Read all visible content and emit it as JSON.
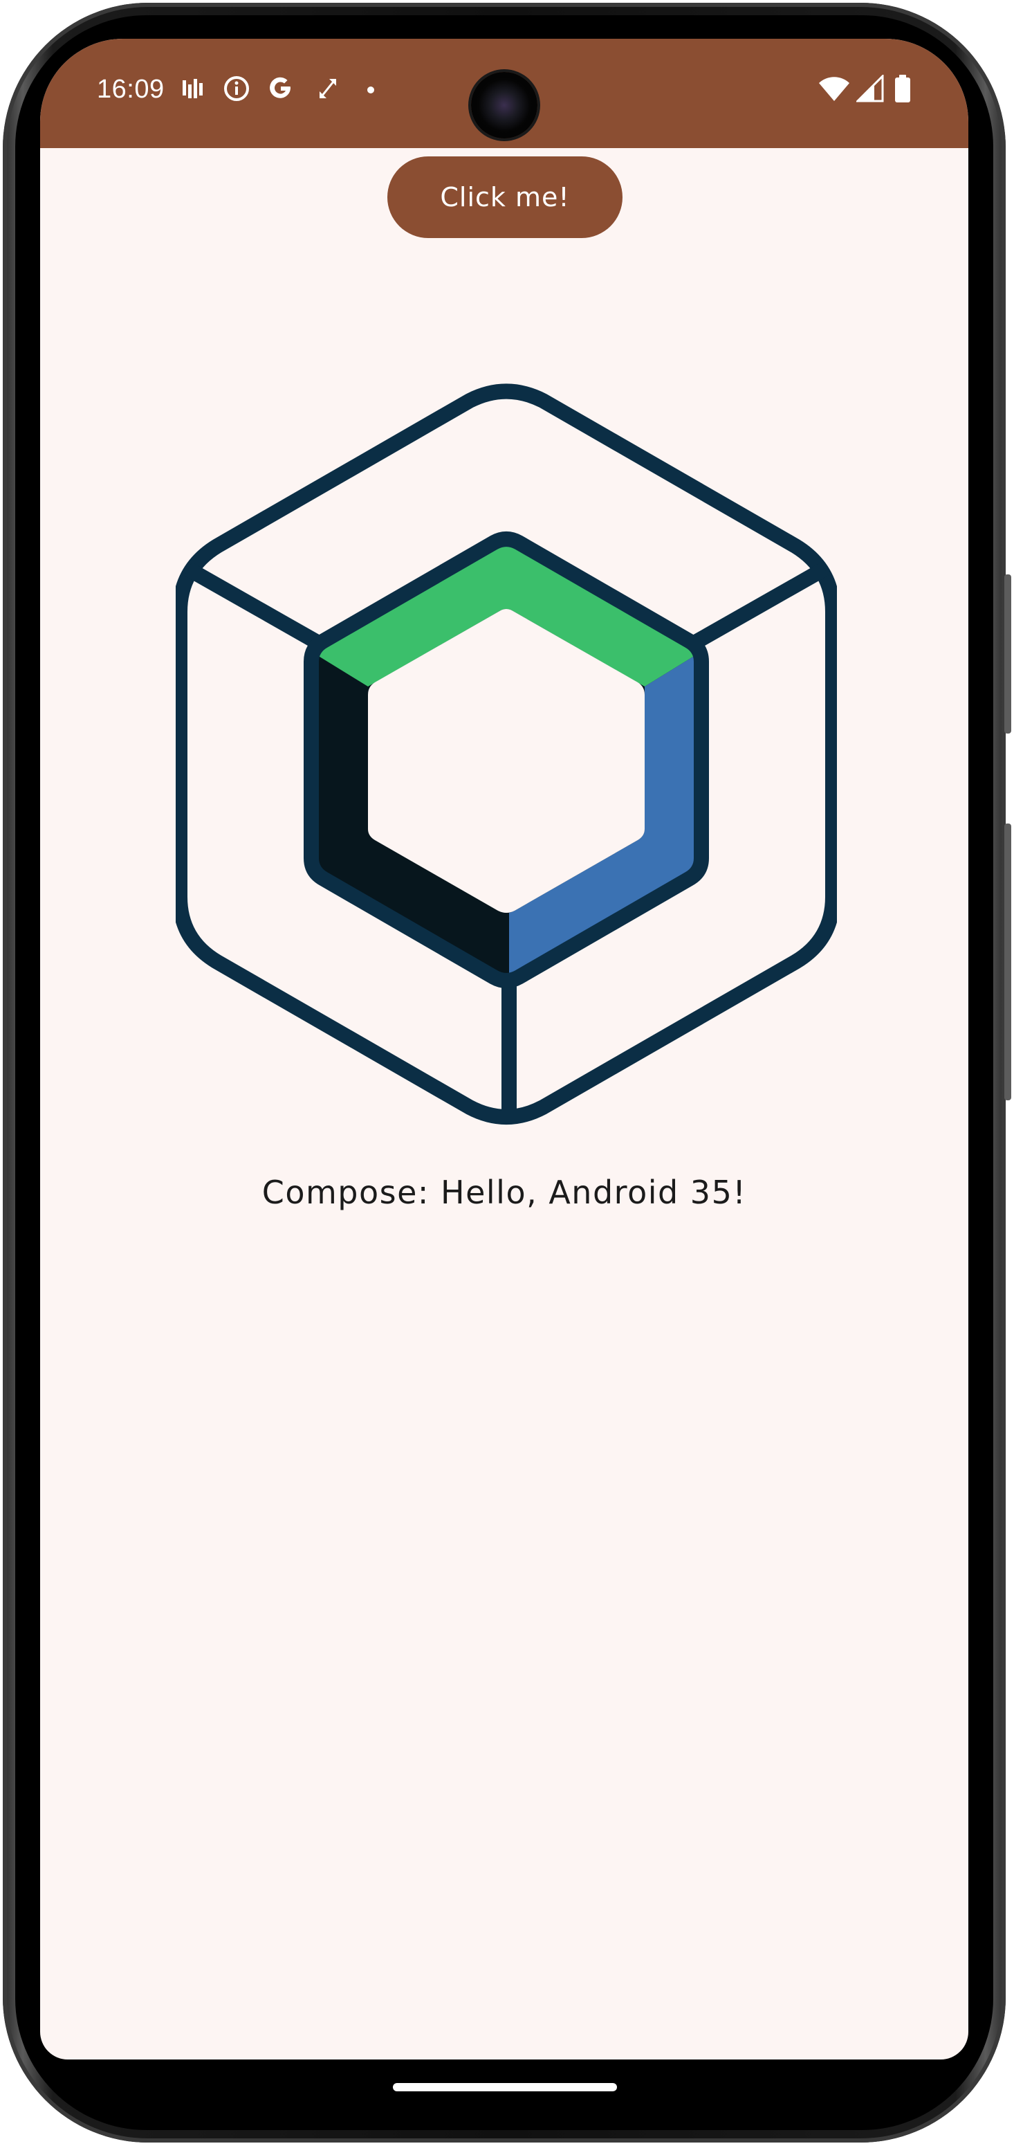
{
  "status_bar": {
    "time": "16:09",
    "background_color": "#8b4e32",
    "left_icons": [
      "signal-bars-icon",
      "info-icon",
      "google-g-icon",
      "arrows-icon",
      "dot-icon"
    ],
    "right_icons": [
      "wifi-icon",
      "cell-signal-icon",
      "battery-icon"
    ]
  },
  "main": {
    "button_label": "Click me!",
    "button_color": "#8b4e32",
    "greeting": "Compose: Hello, Android 35!",
    "background_color": "#fdf5f3"
  },
  "logo": {
    "name": "jetpack-compose-logo",
    "colors": {
      "outline": "#0b2e45",
      "green": "#3bbf6b",
      "blue": "#3b72b3",
      "dark": "#07161d"
    }
  }
}
